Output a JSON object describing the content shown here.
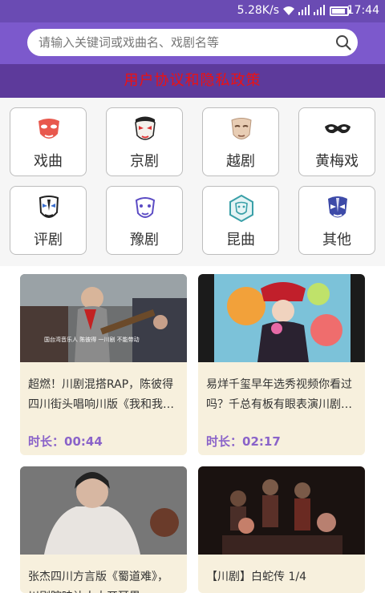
{
  "status_bar": {
    "speed": "5.28K/s",
    "time": "17:44"
  },
  "search": {
    "placeholder": "请输入关键词或戏曲名、戏剧名等"
  },
  "banner": {
    "text": "用户协议和隐私政策"
  },
  "categories": [
    {
      "label": "戏曲",
      "icon": "red-opera-mask-icon"
    },
    {
      "label": "京剧",
      "icon": "peking-opera-face-icon"
    },
    {
      "label": "越剧",
      "icon": "beige-mask-icon"
    },
    {
      "label": "黄梅戏",
      "icon": "eye-mask-icon"
    },
    {
      "label": "评剧",
      "icon": "blue-white-mask-icon"
    },
    {
      "label": "豫剧",
      "icon": "purple-outline-mask-icon"
    },
    {
      "label": "昆曲",
      "icon": "teal-hex-mask-icon"
    },
    {
      "label": "其他",
      "icon": "blue-painted-mask-icon"
    }
  ],
  "videos": [
    {
      "title": "超燃！川剧混搭RAP，陈彼得四川街头唱响川版《我和我…",
      "duration_label": "时长：",
      "duration": "00:44",
      "thumb_overlay": "国台湾音乐人 陈彼得 一川剧 不能带动"
    },
    {
      "title": "易烊千玺早年选秀视频你看过吗？千总有板有眼表演川剧…",
      "duration_label": "时长：",
      "duration": "02:17"
    },
    {
      "title": "张杰四川方言版《蜀道难》，川剧腔味让人大开耳界…",
      "duration_label": "",
      "duration": ""
    },
    {
      "title": "【川剧】白蛇传 1/4",
      "duration_label": "",
      "duration": ""
    }
  ],
  "colors": {
    "statusbar": "#6a4bb3",
    "header": "#7c59cc",
    "banner_bg": "#5d3a9b",
    "banner_text": "#ee1111",
    "duration": "#8a63c9",
    "card_bg": "#f7f0dd"
  }
}
